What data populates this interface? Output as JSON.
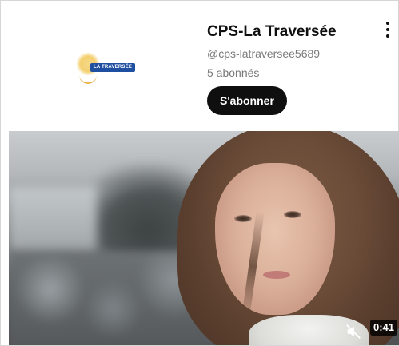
{
  "channel": {
    "logo_text": "LA TRAVERSÉE",
    "name": "CPS-La Traversée",
    "handle": "@cps-latraversee5689",
    "subscribers": "5 abonnés",
    "subscribe_label": "S'abonner"
  },
  "video": {
    "duration": "0:41",
    "mute_icon": "muted-speaker-icon"
  },
  "menu": {
    "icon": "more-vert-icon"
  }
}
